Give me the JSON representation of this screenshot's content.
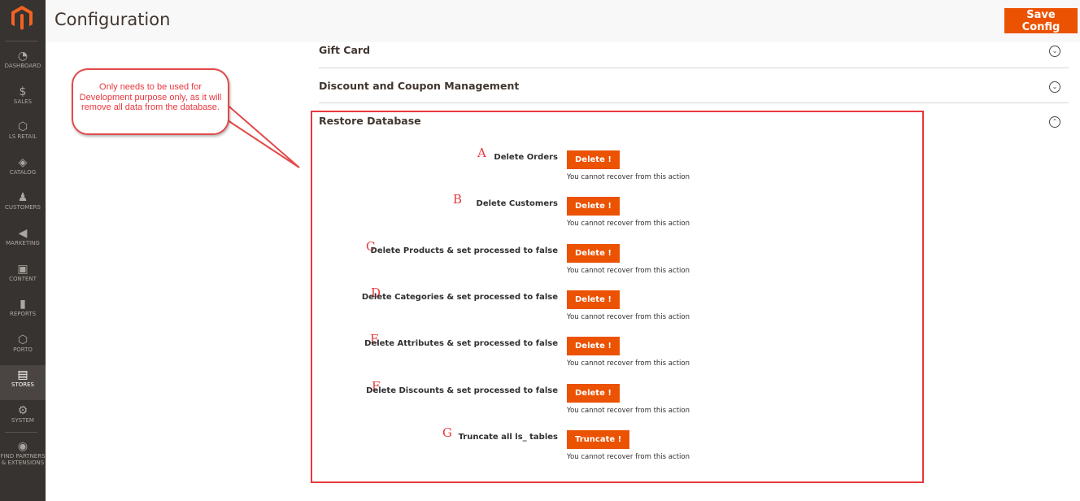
{
  "sidebar": {
    "items": [
      {
        "label": "DASHBOARD",
        "icon": "dashboard-icon",
        "glyph": "◔"
      },
      {
        "label": "SALES",
        "icon": "dollar-icon",
        "glyph": "$"
      },
      {
        "label": "LS RETAIL",
        "icon": "hexagon-icon",
        "glyph": "⬡"
      },
      {
        "label": "CATALOG",
        "icon": "box-icon",
        "glyph": "◈"
      },
      {
        "label": "CUSTOMERS",
        "icon": "person-icon",
        "glyph": "♟"
      },
      {
        "label": "MARKETING",
        "icon": "megaphone-icon",
        "glyph": "◀"
      },
      {
        "label": "CONTENT",
        "icon": "layout-icon",
        "glyph": "▣"
      },
      {
        "label": "REPORTS",
        "icon": "bar-chart-icon",
        "glyph": "▮"
      },
      {
        "label": "PORTO",
        "icon": "hexagon-icon",
        "glyph": "⬡"
      },
      {
        "label": "STORES",
        "icon": "store-icon",
        "glyph": "▤"
      },
      {
        "label": "SYSTEM",
        "icon": "gear-icon",
        "glyph": "⚙"
      },
      {
        "label": "FIND PARTNERS & EXTENSIONS",
        "icon": "blocks-icon",
        "glyph": "◉"
      }
    ]
  },
  "header": {
    "title": "Configuration",
    "save_label": "Save Config"
  },
  "sections": [
    {
      "title": "Gift Card"
    },
    {
      "title": "Discount and Coupon Management"
    },
    {
      "title": "Restore Database"
    }
  ],
  "restore": {
    "note": "You cannot recover from this action",
    "rows": [
      {
        "letter": "A",
        "label": "Delete Orders",
        "button": "Delete !"
      },
      {
        "letter": "B",
        "label": "Delete Customers",
        "button": "Delete !"
      },
      {
        "letter": "C",
        "label": "Delete Products & set processed to false",
        "button": "Delete !"
      },
      {
        "letter": "D",
        "label": "Delete Categories & set processed to false",
        "button": "Delete !"
      },
      {
        "letter": "E",
        "label": "Delete Attributes & set processed to false",
        "button": "Delete !"
      },
      {
        "letter": "F",
        "label": "Delete Discounts & set processed to false",
        "button": "Delete !"
      },
      {
        "letter": "G",
        "label": "Truncate all ls_ tables",
        "button": "Truncate !"
      }
    ]
  },
  "callout": {
    "text": "Only needs to be used for Development purpose only, as it will remove all data from the database."
  },
  "colors": {
    "accent": "#eb5202",
    "annotation": "#e8383d",
    "sidebar": "#373330"
  }
}
